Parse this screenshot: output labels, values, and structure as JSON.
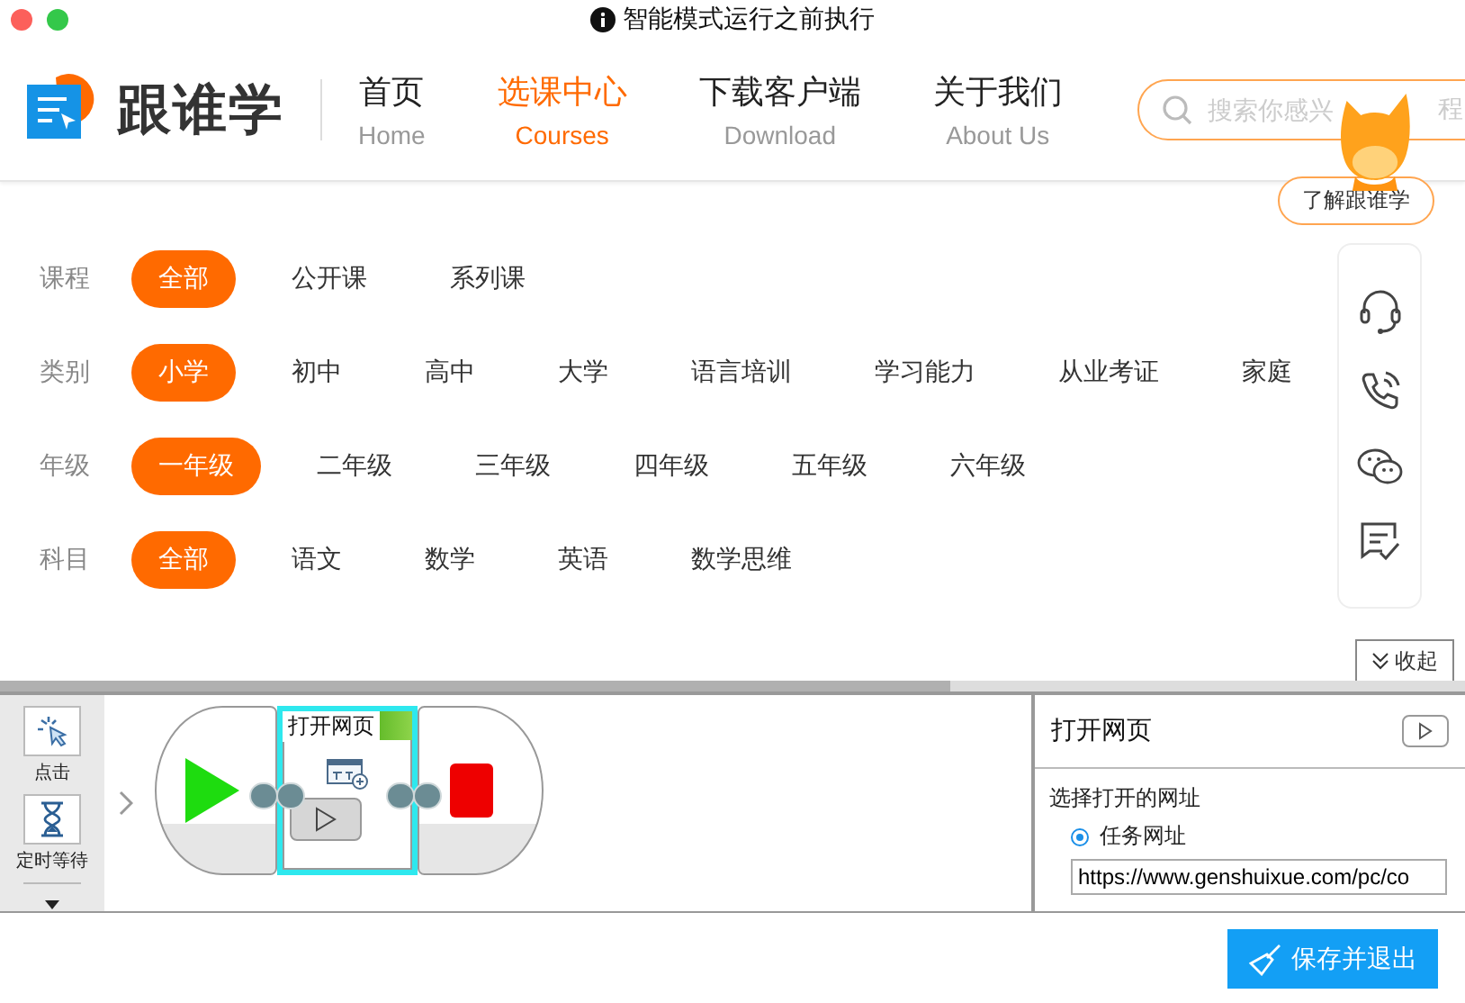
{
  "window": {
    "title": "智能模式运行之前执行"
  },
  "site": {
    "logo": "跟谁学",
    "nav": [
      {
        "label": "首页",
        "sub": "Home",
        "selected": false
      },
      {
        "label": "选课中心",
        "sub": "Courses",
        "selected": true
      },
      {
        "label": "下载客户端",
        "sub": "Download",
        "selected": false
      },
      {
        "label": "关于我们",
        "sub": "About Us",
        "selected": false
      }
    ],
    "search": {
      "placeholder": "搜索你感兴",
      "tail": "程"
    },
    "about_button": "了解跟谁学"
  },
  "filters": [
    {
      "label": "课程",
      "options": [
        {
          "text": "全部",
          "selected": true
        },
        {
          "text": "公开课",
          "selected": false
        },
        {
          "text": "系列课",
          "selected": false
        }
      ]
    },
    {
      "label": "类别",
      "options": [
        {
          "text": "小学",
          "selected": true
        },
        {
          "text": "初中",
          "selected": false
        },
        {
          "text": "高中",
          "selected": false
        },
        {
          "text": "大学",
          "selected": false
        },
        {
          "text": "语言培训",
          "selected": false
        },
        {
          "text": "学习能力",
          "selected": false
        },
        {
          "text": "从业考证",
          "selected": false
        },
        {
          "text": "家庭",
          "selected": false
        }
      ]
    },
    {
      "label": "年级",
      "options": [
        {
          "text": "一年级",
          "selected": true
        },
        {
          "text": "二年级",
          "selected": false
        },
        {
          "text": "三年级",
          "selected": false
        },
        {
          "text": "四年级",
          "selected": false
        },
        {
          "text": "五年级",
          "selected": false
        },
        {
          "text": "六年级",
          "selected": false
        }
      ]
    },
    {
      "label": "科目",
      "options": [
        {
          "text": "全部",
          "selected": true
        },
        {
          "text": "语文",
          "selected": false
        },
        {
          "text": "数学",
          "selected": false
        },
        {
          "text": "英语",
          "selected": false
        },
        {
          "text": "数学思维",
          "selected": false
        }
      ]
    }
  ],
  "collapse_button": "收起",
  "editor": {
    "toolbox": [
      {
        "kind": "click",
        "label": "点击"
      },
      {
        "kind": "timer",
        "label": "定时等待"
      }
    ],
    "blocks": [
      {
        "kind": "start",
        "selected": false
      },
      {
        "kind": "action",
        "title": "打开网页",
        "selected": true
      },
      {
        "kind": "end",
        "selected": false
      }
    ],
    "properties": {
      "title": "打开网页",
      "section": "选择打开的网址",
      "options": [
        {
          "label": "任务网址",
          "selected": true
        }
      ],
      "url": "https://www.genshuixue.com/pc/co"
    },
    "save_button": "保存并退出"
  }
}
